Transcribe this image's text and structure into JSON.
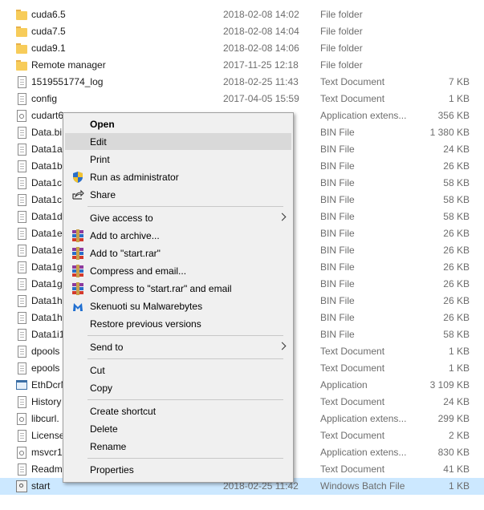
{
  "files": [
    {
      "name": "cuda6.5",
      "date": "2018-02-08 14:02",
      "type": "File folder",
      "size": "",
      "icon": "folder"
    },
    {
      "name": "cuda7.5",
      "date": "2018-02-08 14:04",
      "type": "File folder",
      "size": "",
      "icon": "folder"
    },
    {
      "name": "cuda9.1",
      "date": "2018-02-08 14:06",
      "type": "File folder",
      "size": "",
      "icon": "folder"
    },
    {
      "name": "Remote manager",
      "date": "2017-11-25 12:18",
      "type": "File folder",
      "size": "",
      "icon": "folder"
    },
    {
      "name": "1519551774_log",
      "date": "2018-02-25 11:43",
      "type": "Text Document",
      "size": "7 KB",
      "icon": "doc"
    },
    {
      "name": "config",
      "date": "2017-04-05 15:59",
      "type": "Text Document",
      "size": "1 KB",
      "icon": "doc"
    },
    {
      "name": "cudart6",
      "date": "",
      "type": "Application extens...",
      "size": "356 KB",
      "icon": "dll"
    },
    {
      "name": "Data.bi",
      "date": "",
      "type": "BIN File",
      "size": "1 380 KB",
      "icon": "doc"
    },
    {
      "name": "Data1a",
      "date": "",
      "type": "BIN File",
      "size": "24 KB",
      "icon": "doc"
    },
    {
      "name": "Data1b",
      "date": "",
      "type": "BIN File",
      "size": "26 KB",
      "icon": "doc"
    },
    {
      "name": "Data1c",
      "date": "",
      "type": "BIN File",
      "size": "58 KB",
      "icon": "doc"
    },
    {
      "name": "Data1c",
      "date": "",
      "type": "BIN File",
      "size": "58 KB",
      "icon": "doc"
    },
    {
      "name": "Data1d",
      "date": "",
      "type": "BIN File",
      "size": "58 KB",
      "icon": "doc"
    },
    {
      "name": "Data1e",
      "date": "",
      "type": "BIN File",
      "size": "26 KB",
      "icon": "doc"
    },
    {
      "name": "Data1e",
      "date": "",
      "type": "BIN File",
      "size": "26 KB",
      "icon": "doc"
    },
    {
      "name": "Data1g",
      "date": "",
      "type": "BIN File",
      "size": "26 KB",
      "icon": "doc"
    },
    {
      "name": "Data1g",
      "date": "",
      "type": "BIN File",
      "size": "26 KB",
      "icon": "doc"
    },
    {
      "name": "Data1h",
      "date": "",
      "type": "BIN File",
      "size": "26 KB",
      "icon": "doc"
    },
    {
      "name": "Data1h",
      "date": "",
      "type": "BIN File",
      "size": "26 KB",
      "icon": "doc"
    },
    {
      "name": "Data1i1",
      "date": "",
      "type": "BIN File",
      "size": "58 KB",
      "icon": "doc"
    },
    {
      "name": "dpools",
      "date": "",
      "type": "Text Document",
      "size": "1 KB",
      "icon": "doc"
    },
    {
      "name": "epools",
      "date": "",
      "type": "Text Document",
      "size": "1 KB",
      "icon": "doc"
    },
    {
      "name": "EthDcrM",
      "date": "",
      "type": "Application",
      "size": "3 109 KB",
      "icon": "app"
    },
    {
      "name": "History",
      "date": "",
      "type": "Text Document",
      "size": "24 KB",
      "icon": "doc"
    },
    {
      "name": "libcurl.",
      "date": "",
      "type": "Application extens...",
      "size": "299 KB",
      "icon": "dll"
    },
    {
      "name": "License",
      "date": "",
      "type": "Text Document",
      "size": "2 KB",
      "icon": "doc"
    },
    {
      "name": "msvcr1",
      "date": "",
      "type": "Application extens...",
      "size": "830 KB",
      "icon": "dll"
    },
    {
      "name": "Readm",
      "date": "",
      "type": "Text Document",
      "size": "41 KB",
      "icon": "doc"
    },
    {
      "name": "start",
      "date": "2018-02-25 11:42",
      "type": "Windows Batch File",
      "size": "1 KB",
      "icon": "bat",
      "selected": true
    }
  ],
  "context_menu": {
    "items": [
      {
        "kind": "item",
        "label": "Open",
        "bold": true
      },
      {
        "kind": "item",
        "label": "Edit",
        "hover": true
      },
      {
        "kind": "item",
        "label": "Print"
      },
      {
        "kind": "item",
        "label": "Run as administrator",
        "icon": "shield-icon"
      },
      {
        "kind": "item",
        "label": "Share",
        "icon": "share-icon"
      },
      {
        "kind": "sep"
      },
      {
        "kind": "item",
        "label": "Give access to",
        "submenu": true
      },
      {
        "kind": "item",
        "label": "Add to archive...",
        "icon": "winrar-icon"
      },
      {
        "kind": "item",
        "label": "Add to \"start.rar\"",
        "icon": "winrar-icon"
      },
      {
        "kind": "item",
        "label": "Compress and email...",
        "icon": "winrar-icon"
      },
      {
        "kind": "item",
        "label": "Compress to \"start.rar\" and email",
        "icon": "winrar-icon"
      },
      {
        "kind": "item",
        "label": "Skenuoti su Malwarebytes",
        "icon": "malwarebytes-icon"
      },
      {
        "kind": "item",
        "label": "Restore previous versions"
      },
      {
        "kind": "sep"
      },
      {
        "kind": "item",
        "label": "Send to",
        "submenu": true
      },
      {
        "kind": "sep"
      },
      {
        "kind": "item",
        "label": "Cut"
      },
      {
        "kind": "item",
        "label": "Copy"
      },
      {
        "kind": "sep"
      },
      {
        "kind": "item",
        "label": "Create shortcut"
      },
      {
        "kind": "item",
        "label": "Delete"
      },
      {
        "kind": "item",
        "label": "Rename"
      },
      {
        "kind": "sep"
      },
      {
        "kind": "item",
        "label": "Properties"
      }
    ]
  },
  "colors": {
    "selection": "#cce8ff",
    "menu_bg": "#f0f0f0",
    "menu_hover": "#d9d9d9",
    "folder": "#f7cc5a"
  }
}
